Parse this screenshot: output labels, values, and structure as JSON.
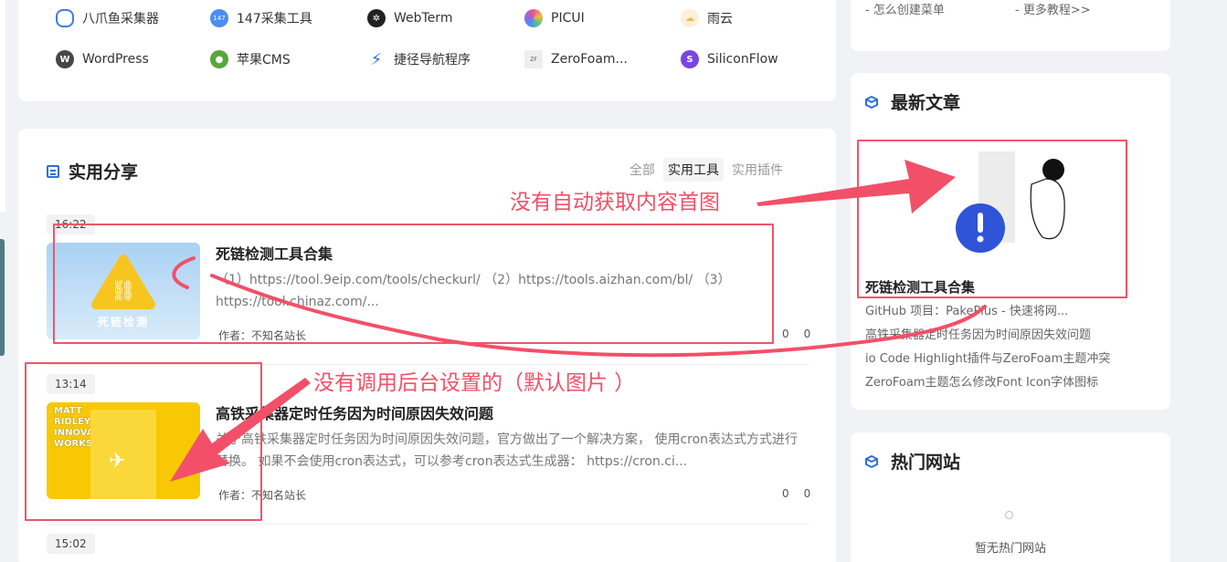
{
  "links": [
    {
      "label": "八爪鱼采集器",
      "icon": "octopus-icon",
      "color": "#3e7de0"
    },
    {
      "label": "147采集工具",
      "icon": "147seo-icon",
      "color": "#4a8ef0"
    },
    {
      "label": "WebTerm",
      "icon": "webterm-icon",
      "color": "#222222"
    },
    {
      "label": "PICUI",
      "icon": "picui-icon",
      "color": "#e85a8a"
    },
    {
      "label": "雨云",
      "icon": "cloud-icon",
      "color": "#f5b942"
    },
    {
      "label": "WordPress",
      "icon": "wordpress-icon",
      "color": "#464646"
    },
    {
      "label": "苹果CMS",
      "icon": "applecms-icon",
      "color": "#5aa63a"
    },
    {
      "label": "捷径导航程序",
      "icon": "lightning-icon",
      "color": "#2f6fde"
    },
    {
      "label": "ZeroFoam...",
      "icon": "zerofoam-icon",
      "color": "#777777"
    },
    {
      "label": "SiliconFlow",
      "icon": "siliconflow-icon",
      "color": "#7a45e0"
    }
  ],
  "share": {
    "title": "实用分享",
    "tabs": [
      "全部",
      "实用工具",
      "实用插件"
    ],
    "active_tab": "实用工具",
    "posts": [
      {
        "time": "16:22",
        "title": "死链检测工具合集",
        "excerpt": "（1）https://tool.9eip.com/tools/checkurl/ （2）https://tools.aizhan.com/bl/ （3）https://tool.chinaz.com/...",
        "author": "作者：不知名站长",
        "views": "0",
        "likes": "0",
        "thumb_text": "死链检测"
      },
      {
        "time": "13:14",
        "title": "高铁采集器定时任务因为时间原因失效问题",
        "excerpt": "关于高铁采集器定时任务因为时间原因失效问题，官方做出了一个解决方案， 使用cron表达式方式进行替换。 如果不会使用cron表达式，可以参考cron表达式生成器： https://cron.ci...",
        "author": "作者：不知名站长",
        "views": "0",
        "likes": "0",
        "thumb_text": "MATT RIDLEY HOW INNOVATION WORKS"
      }
    ],
    "next_time": "15:02"
  },
  "sidebar": {
    "top_links": [
      "- 怎么创建菜单",
      "- 更多教程>>"
    ],
    "latest_title": "最新文章",
    "latest_featured_title": "死链检测工具合集",
    "latest_list": [
      "GitHub 项目：PakePlus - 快速将网...",
      "高铁采集器定时任务因为时间原因失效问题",
      "io Code Highlight插件与ZeroFoam主题冲突",
      "ZeroFoam主题怎么修改Font Icon字体图标"
    ],
    "hot_title": "热门网站",
    "hot_empty": "暂无热门网站"
  },
  "annotations": {
    "no_auto_image": "没有自动获取内容首图",
    "no_default_image": "没有调用后台设置的（默认图片 ）"
  },
  "colors": {
    "accent": "#2f6fde",
    "annotation": "#f25068"
  }
}
